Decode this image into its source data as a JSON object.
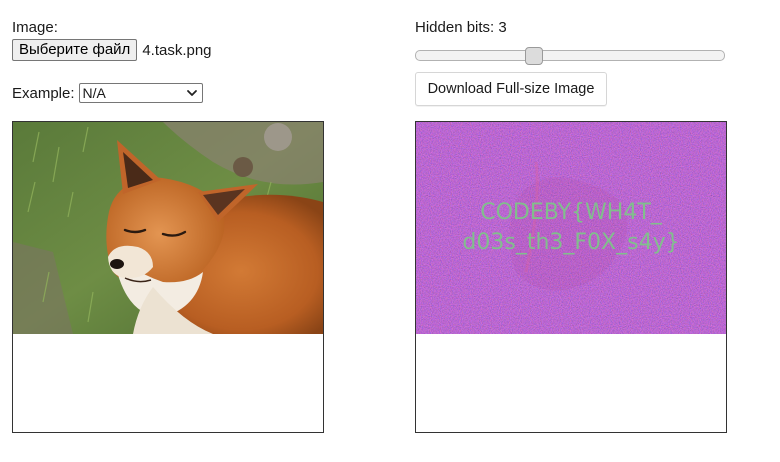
{
  "form": {
    "image_label": "Image:",
    "file_button_label": "Выберите файл",
    "file_name": "4.task.png",
    "example_label": "Example:",
    "example_selected": "N/A"
  },
  "controls": {
    "hidden_bits_label": "Hidden bits: 3",
    "hidden_bits_value": 3,
    "hidden_bits_max": 8,
    "download_button_label": "Download Full-size Image"
  },
  "images": {
    "left_icon": "fox-photo",
    "right_icon": "noise-reveal",
    "right_text_lines": [
      "CODEBY{WH4T_",
      "d03s_th3_F0X_s4y}"
    ],
    "noise_color": "#6a2a8c",
    "text_color": "#7fc48a"
  }
}
